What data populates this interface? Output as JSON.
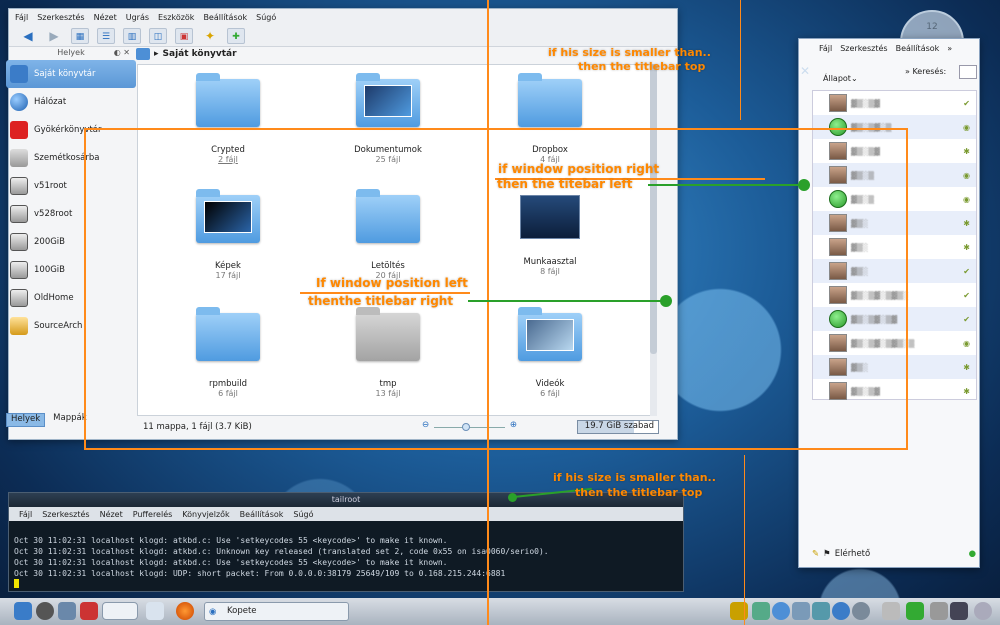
{
  "dolphin": {
    "menu": [
      "Fájl",
      "Szerkesztés",
      "Nézet",
      "Ugrás",
      "Eszközök",
      "Beállítások",
      "Súgó"
    ],
    "places_title": "Helyek",
    "places": [
      "Saját könyvtár",
      "Hálózat",
      "Gyökérkönyvtár",
      "Szemétkosárba",
      "v51root",
      "v528root",
      "200GiB",
      "100GiB",
      "OldHome",
      "SourceArch"
    ],
    "panel_tabs": [
      "Helyek",
      "Mappák"
    ],
    "breadcrumb": "Saját könyvtár",
    "items": [
      {
        "name": "Crypted",
        "count": "2 fájl"
      },
      {
        "name": "Dokumentumok",
        "count": "25 fájl"
      },
      {
        "name": "Dropbox",
        "count": "4 fájl"
      },
      {
        "name": "Képek",
        "count": "17 fájl"
      },
      {
        "name": "Letöltés",
        "count": "20 fájl"
      },
      {
        "name": "Munkaasztal",
        "count": "8 fájl"
      },
      {
        "name": "rpmbuild",
        "count": "6 fájl"
      },
      {
        "name": "tmp",
        "count": "13 fájl"
      },
      {
        "name": "Videók",
        "count": "6 fájl"
      }
    ],
    "status": "11 mappa, 1 fájl (3.7 KiB)",
    "free_space": "19.7 GiB szabad"
  },
  "kopete": {
    "menu": [
      "Fájl",
      "Szerkesztés",
      "Beállítások",
      "»"
    ],
    "status_label": "Állapot",
    "search_label": "Keresés:",
    "footer_status": "Elérhető",
    "contacts": 13
  },
  "terminal": {
    "title": "tailroot",
    "menu": [
      "Fájl",
      "Szerkesztés",
      "Nézet",
      "Pufferelés",
      "Könyvjelzők",
      "Beállítások",
      "Súgó"
    ],
    "lines": [
      "Oct 30 11:02:31 localhost klogd: atkbd.c: Use 'setkeycodes 55 <keycode>' to make it known.",
      "Oct 30 11:02:31 localhost klogd: atkbd.c: Unknown key released (translated set 2, code 0x55 on isa0060/serio0).",
      "Oct 30 11:02:31 localhost klogd: atkbd.c: Use 'setkeycodes 55 <keycode>' to make it known.",
      "Oct 30 11:02:31 localhost klogd: UDP: short packet: From 0.0.0.0:38179 25649/109 to 0.168.215.244:6881"
    ]
  },
  "taskbar": {
    "task_label": "Kopete"
  },
  "clock": {
    "label": "12"
  },
  "annotations": {
    "top_right_1": "if his size is smaller than..",
    "top_right_2": "then the titlebar top",
    "right_1": "if window position right",
    "right_2": "then the titebar left",
    "left_1": "If window position left",
    "left_2": "thenthe titlebar right",
    "bottom_1": "if his size is smaller than..",
    "bottom_2": "then the titlebar top"
  },
  "colors": {
    "annotation": "#ff8800",
    "connector": "#2aa02a"
  }
}
